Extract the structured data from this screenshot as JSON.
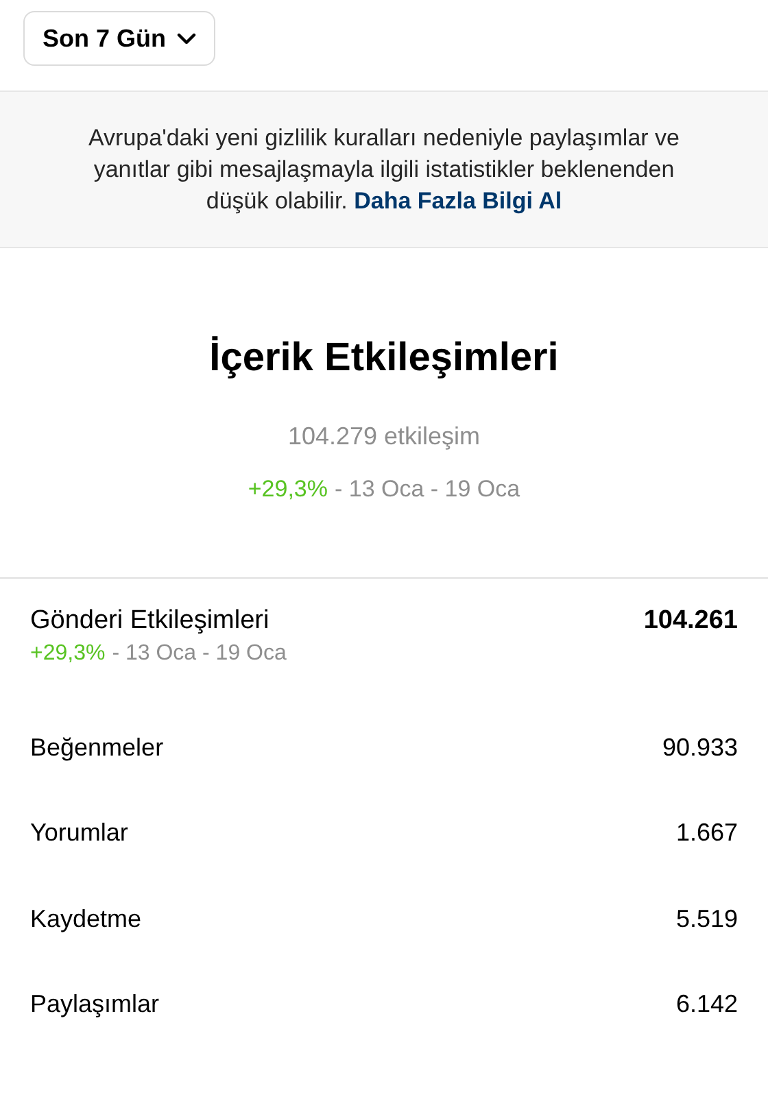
{
  "period_button": {
    "label": "Son 7 Gün"
  },
  "notice": {
    "text": "Avrupa'daki yeni gizlilik kuralları nedeniyle paylaşımlar ve yanıtlar gibi mesajlaşmayla ilgili istatistikler beklenenden düşük olabilir.",
    "link": "Daha Fazla Bilgi Al"
  },
  "summary": {
    "title": "İçerik Etkileşimleri",
    "total": "104.279 etkileşim",
    "change": "+29,3%",
    "range": "- 13 Oca - 19 Oca"
  },
  "section": {
    "title": "Gönderi Etkileşimleri",
    "value": "104.261",
    "change": "+29,3%",
    "range": "- 13 Oca - 19 Oca"
  },
  "rows": [
    {
      "label": "Beğenmeler",
      "value": "90.933"
    },
    {
      "label": "Yorumlar",
      "value": "1.667"
    },
    {
      "label": "Kaydetme",
      "value": "5.519"
    },
    {
      "label": "Paylaşımlar",
      "value": "6.142"
    }
  ]
}
